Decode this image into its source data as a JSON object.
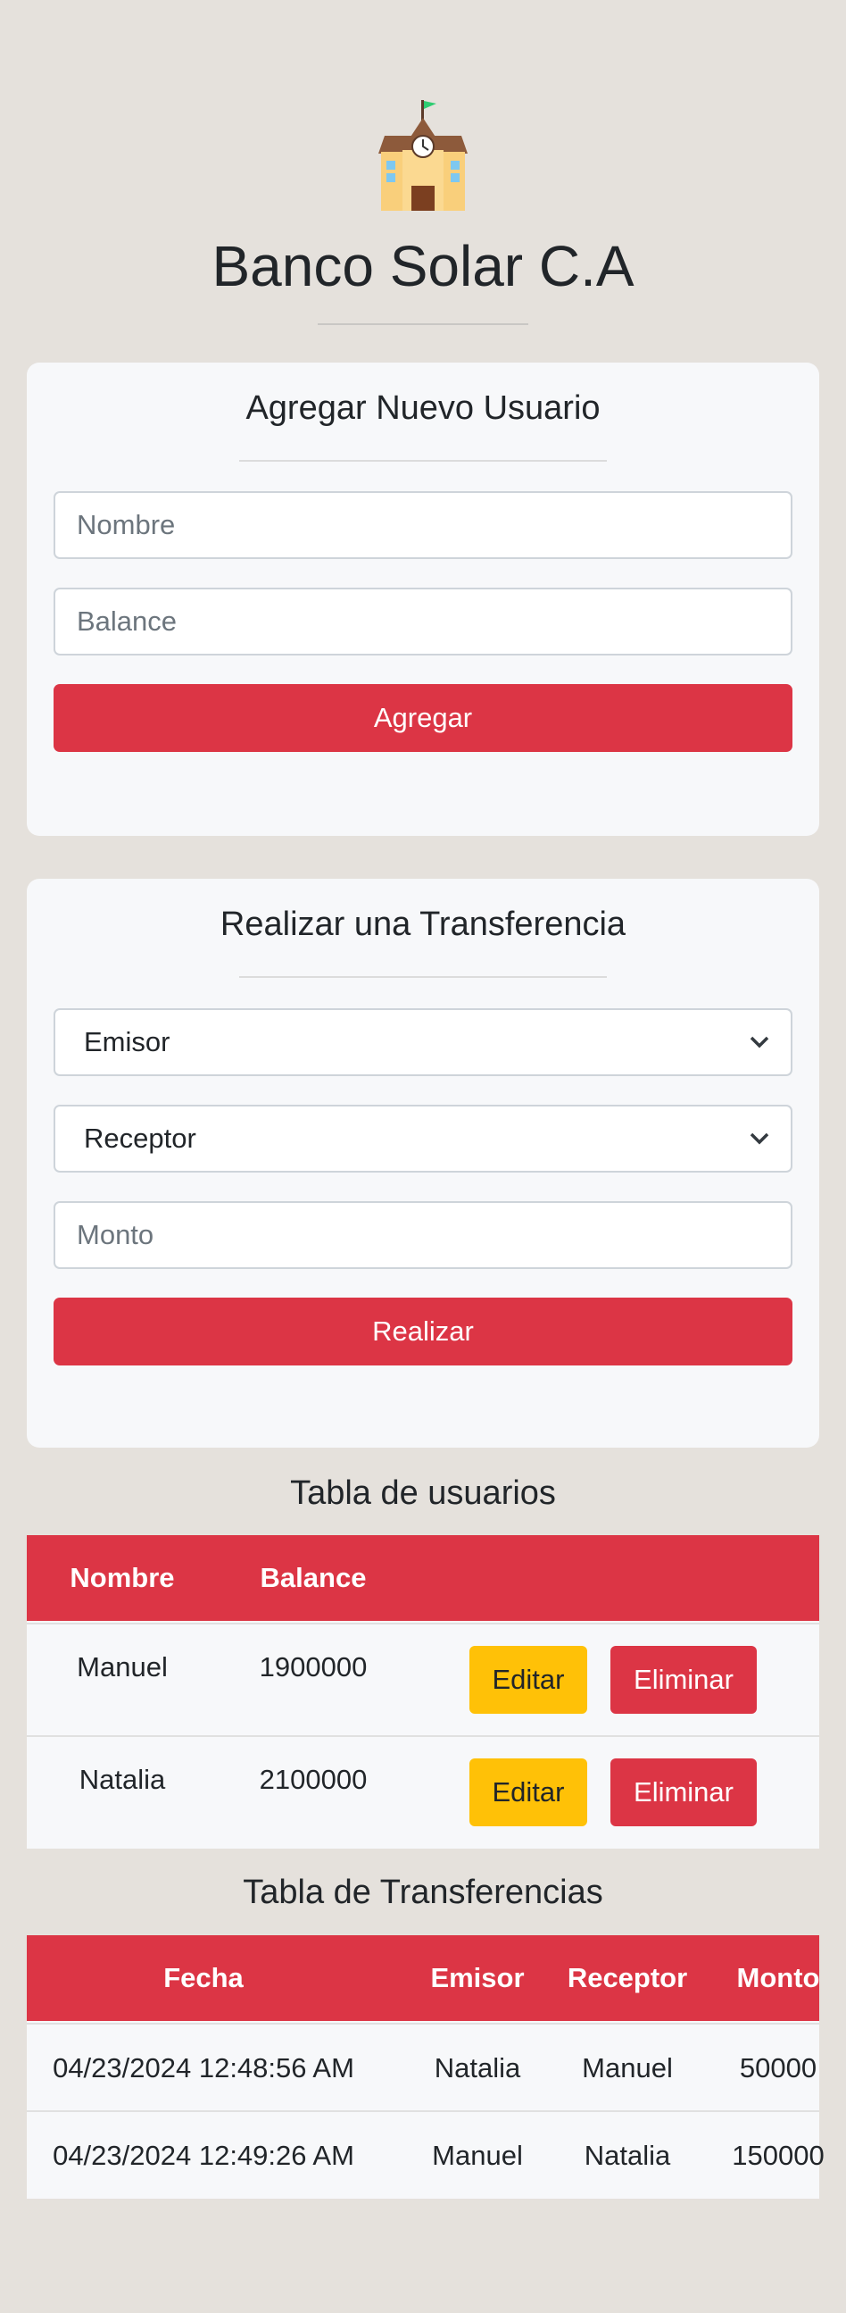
{
  "header": {
    "title": "Banco Solar C.A",
    "logo_icon": "school-building-icon"
  },
  "add_user": {
    "title": "Agregar Nuevo Usuario",
    "name_placeholder": "Nombre",
    "balance_placeholder": "Balance",
    "submit_label": "Agregar"
  },
  "transfer": {
    "title": "Realizar una Transferencia",
    "sender_selected": "Emisor",
    "receiver_selected": "Receptor",
    "amount_placeholder": "Monto",
    "submit_label": "Realizar"
  },
  "users_table": {
    "title": "Tabla de usuarios",
    "columns": [
      "Nombre",
      "Balance"
    ],
    "rows": [
      {
        "name": "Manuel",
        "balance": "1900000",
        "edit_label": "Editar",
        "delete_label": "Eliminar"
      },
      {
        "name": "Natalia",
        "balance": "2100000",
        "edit_label": "Editar",
        "delete_label": "Eliminar"
      }
    ]
  },
  "transfers_table": {
    "title": "Tabla de Transferencias",
    "columns": [
      "Fecha",
      "Emisor",
      "Receptor",
      "Monto"
    ],
    "rows": [
      {
        "date": "04/23/2024 12:48:56 AM",
        "sender": "Natalia",
        "receiver": "Manuel",
        "amount": "50000"
      },
      {
        "date": "04/23/2024 12:49:26 AM",
        "sender": "Manuel",
        "receiver": "Natalia",
        "amount": "150000"
      }
    ]
  },
  "colors": {
    "background": "#e5e1dc",
    "primary_red": "#dc3545",
    "warning_yellow": "#ffc107",
    "card": "#f7f8fa"
  }
}
